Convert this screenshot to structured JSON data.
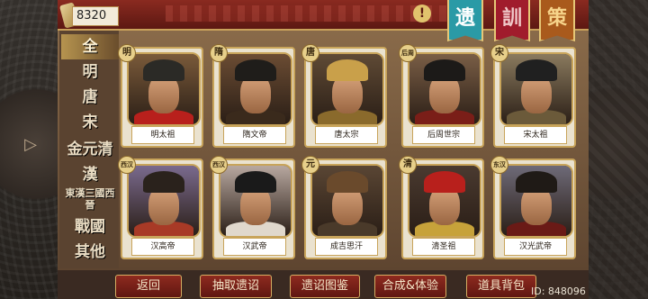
{
  "currency": {
    "value": "8320"
  },
  "tabs": [
    {
      "label": "遗"
    },
    {
      "label": "訓"
    },
    {
      "label": "策"
    }
  ],
  "categories": [
    {
      "label": "全",
      "active": true
    },
    {
      "label": "明"
    },
    {
      "label": "唐"
    },
    {
      "label": "宋"
    },
    {
      "label": "金元清"
    },
    {
      "label": "漢"
    },
    {
      "label": "東漢三國西晉"
    },
    {
      "label": "戰國"
    },
    {
      "label": "其他"
    }
  ],
  "heroes": [
    {
      "name": "明太祖",
      "badge": "明",
      "hat": "#2b2a26",
      "robe": "#b8201c",
      "bg": "#7a5a3a"
    },
    {
      "name": "隋文帝",
      "badge": "隋",
      "hat": "#1f1d1a",
      "robe": "#3a2a1c",
      "bg": "#6b4c33"
    },
    {
      "name": "唐太宗",
      "badge": "唐",
      "hat": "#c9a04a",
      "robe": "#8a6a2c",
      "bg": "#5f4a35"
    },
    {
      "name": "后周世宗",
      "badge": "后周",
      "hat": "#1c1a18",
      "robe": "#7a1e18",
      "bg": "#7a5e46"
    },
    {
      "name": "宋太祖",
      "badge": "宋",
      "hat": "#202020",
      "robe": "#6b5a3a",
      "bg": "#8a7a5e"
    },
    {
      "name": "汉高帝",
      "badge": "西汉",
      "hat": "#2a221c",
      "robe": "#a83a26",
      "bg": "#7a6a8e"
    },
    {
      "name": "汉武帝",
      "badge": "西汉",
      "hat": "#1a1a1a",
      "robe": "#e0d8cc",
      "bg": "#b8a8a0"
    },
    {
      "name": "成吉思汗",
      "badge": "元",
      "hat": "#6a4a2c",
      "robe": "#4a3a2a",
      "bg": "#5a4634"
    },
    {
      "name": "清圣祖",
      "badge": "清",
      "hat": "#b8201c",
      "robe": "#c7a23a",
      "bg": "#4a3a30"
    },
    {
      "name": "汉光武帝",
      "badge": "东汉",
      "hat": "#1f1a16",
      "robe": "#6a1a16",
      "bg": "#6e6a78"
    }
  ],
  "buttons": [
    {
      "label": "返回"
    },
    {
      "label": "抽取遗诏"
    },
    {
      "label": "遗诏图鉴"
    },
    {
      "label": "合成&体验"
    },
    {
      "label": "道具背包"
    }
  ],
  "user_id": "ID: 848096",
  "alert_symbol": "!"
}
